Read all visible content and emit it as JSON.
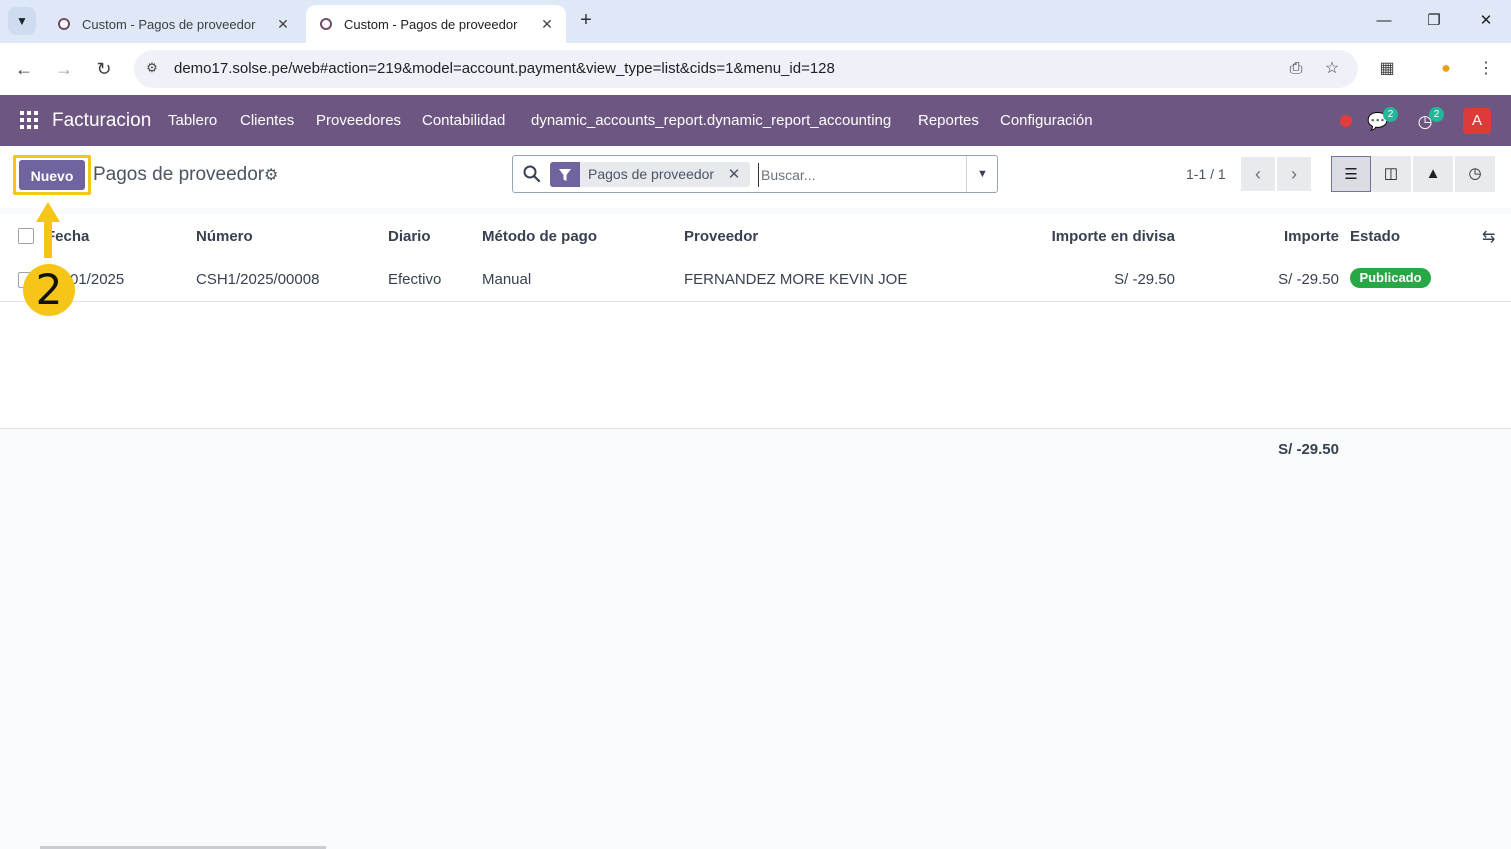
{
  "browser": {
    "tabs": [
      {
        "title": "Custom - Pagos de proveedor",
        "active": false
      },
      {
        "title": "Custom - Pagos de proveedor",
        "active": true
      }
    ],
    "url": "demo17.solse.pe/web#action=219&model=account.payment&view_type=list&cids=1&menu_id=128",
    "icons": [
      "chevron-down-icon",
      "close-icon",
      "plus-icon",
      "minimize-icon",
      "restore-icon",
      "back-icon",
      "forward-icon",
      "reload-icon",
      "site-info-icon",
      "install-icon",
      "star-icon",
      "extensions-icon",
      "profile-icon",
      "kebab-menu-icon"
    ]
  },
  "navbar": {
    "brand": "Facturacion",
    "menu": [
      "Tablero",
      "Clientes",
      "Proveedores",
      "Contabilidad",
      "dynamic_accounts_report.dynamic_report_accounting",
      "Reportes",
      "Configuración"
    ],
    "messages_count": "2",
    "activities_count": "2",
    "avatar_letter": "A",
    "accent_color": "#6e5683"
  },
  "control": {
    "new_button": "Nuevo",
    "title": "Pagos de proveedor",
    "facet": "Pagos de proveedor",
    "search_placeholder": "Buscar...",
    "pager": "1-1 / 1"
  },
  "table": {
    "headers": {
      "fecha": "Fecha",
      "numero": "Número",
      "diario": "Diario",
      "metodo": "Método de pago",
      "proveedor": "Proveedor",
      "importe_divisa": "Importe en divisa",
      "importe": "Importe",
      "estado": "Estado"
    },
    "rows": [
      {
        "fecha": "01/2025",
        "numero": "CSH1/2025/00008",
        "diario": "Efectivo",
        "metodo": "Manual",
        "proveedor": "FERNANDEZ MORE KEVIN JOE",
        "importe_divisa": "S/ -29.50",
        "importe": "S/ -29.50",
        "estado": "Publicado"
      }
    ],
    "total": "S/ -29.50"
  },
  "annotation": {
    "step": "2",
    "highlight_color": "#f5c518"
  }
}
